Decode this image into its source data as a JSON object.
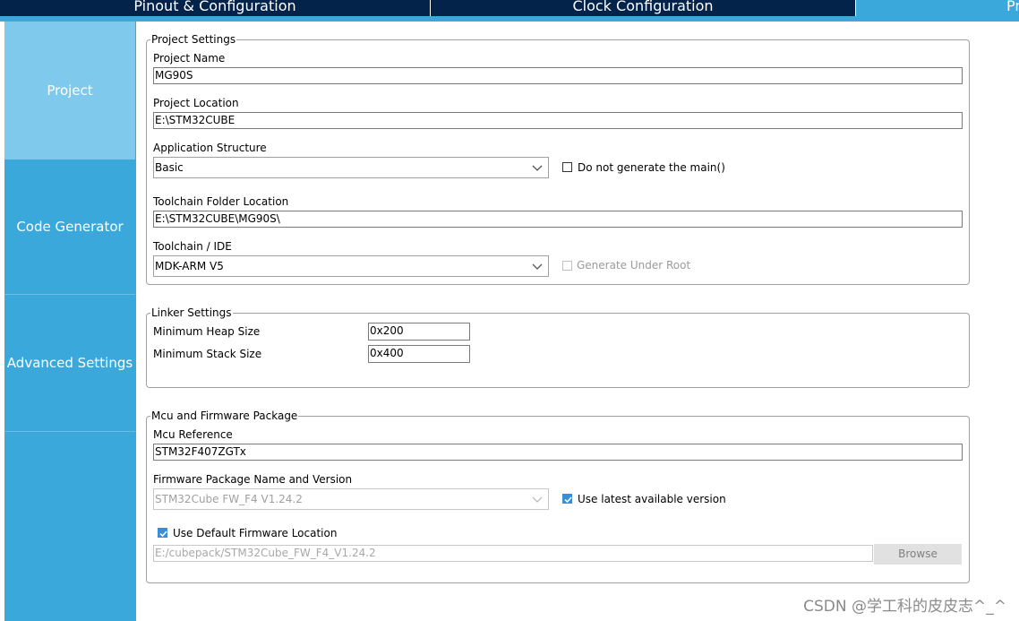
{
  "top_tabs": [
    "Pinout & Configuration",
    "Clock Configuration",
    "Project Manager"
  ],
  "side_tabs": [
    "Project",
    "Code Generator",
    "Advanced Settings"
  ],
  "project_settings": {
    "title": "Project Settings",
    "project_name_label": "Project Name",
    "project_name": "MG90S",
    "project_location_label": "Project Location",
    "project_location": "E:\\STM32CUBE",
    "app_structure_label": "Application Structure",
    "app_structure": "Basic",
    "no_main_label": "Do not generate the main()",
    "toolchain_folder_label": "Toolchain Folder Location",
    "toolchain_folder": "E:\\STM32CUBE\\MG90S\\",
    "toolchain_ide_label": "Toolchain / IDE",
    "toolchain_ide": "MDK-ARM V5",
    "gen_under_root_label": "Generate Under Root"
  },
  "linker_settings": {
    "title": "Linker Settings",
    "heap_label": "Minimum Heap Size",
    "heap_value": "0x200",
    "stack_label": "Minimum Stack Size",
    "stack_value": "0x400"
  },
  "mcu_firmware": {
    "title": "Mcu and Firmware Package",
    "mcu_ref_label": "Mcu Reference",
    "mcu_ref": "STM32F407ZGTx",
    "fw_label": "Firmware Package Name and Version",
    "fw_value": "STM32Cube FW_F4 V1.24.2",
    "use_latest_label": "Use latest available version",
    "use_default_label": "Use Default Firmware Location",
    "fw_path": "E:/cubepack/STM32Cube_FW_F4_V1.24.2",
    "browse_label": "Browse"
  },
  "watermark": "CSDN @学工科的皮皮志^_^",
  "colors": {
    "navy": "#03234b",
    "accent": "#3ba8dc",
    "selected": "#7fc9ec"
  }
}
